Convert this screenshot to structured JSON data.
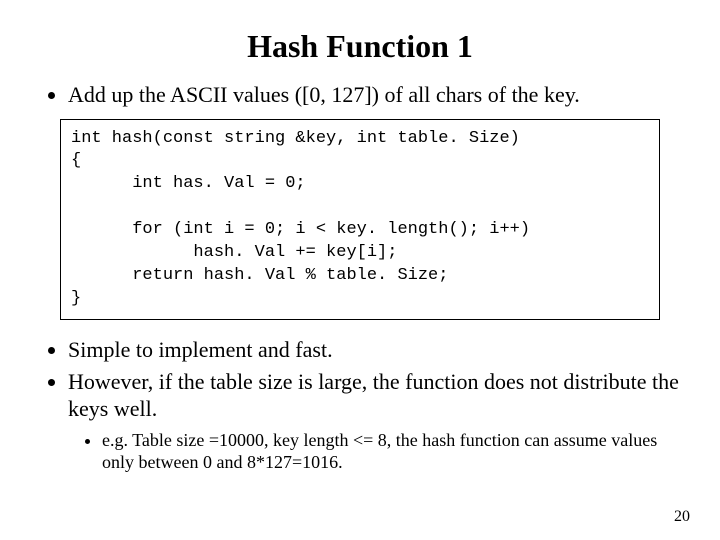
{
  "title": "Hash Function 1",
  "bullets": {
    "intro": "Add up the ASCII values ([0, 127]) of all chars of the key."
  },
  "code": "int hash(const string &key, int table. Size)\n{\n      int has. Val = 0;\n\n      for (int i = 0; i < key. length(); i++)\n            hash. Val += key[i];\n      return hash. Val % table. Size;\n}",
  "bullets2": {
    "b1": "Simple to implement and fast.",
    "b2": "However, if the table size is large, the function does not distribute the keys well.",
    "sub": "e.g. Table size =10000, key length <= 8, the hash function can assume values only between 0 and 8*127=1016."
  },
  "page": "20"
}
